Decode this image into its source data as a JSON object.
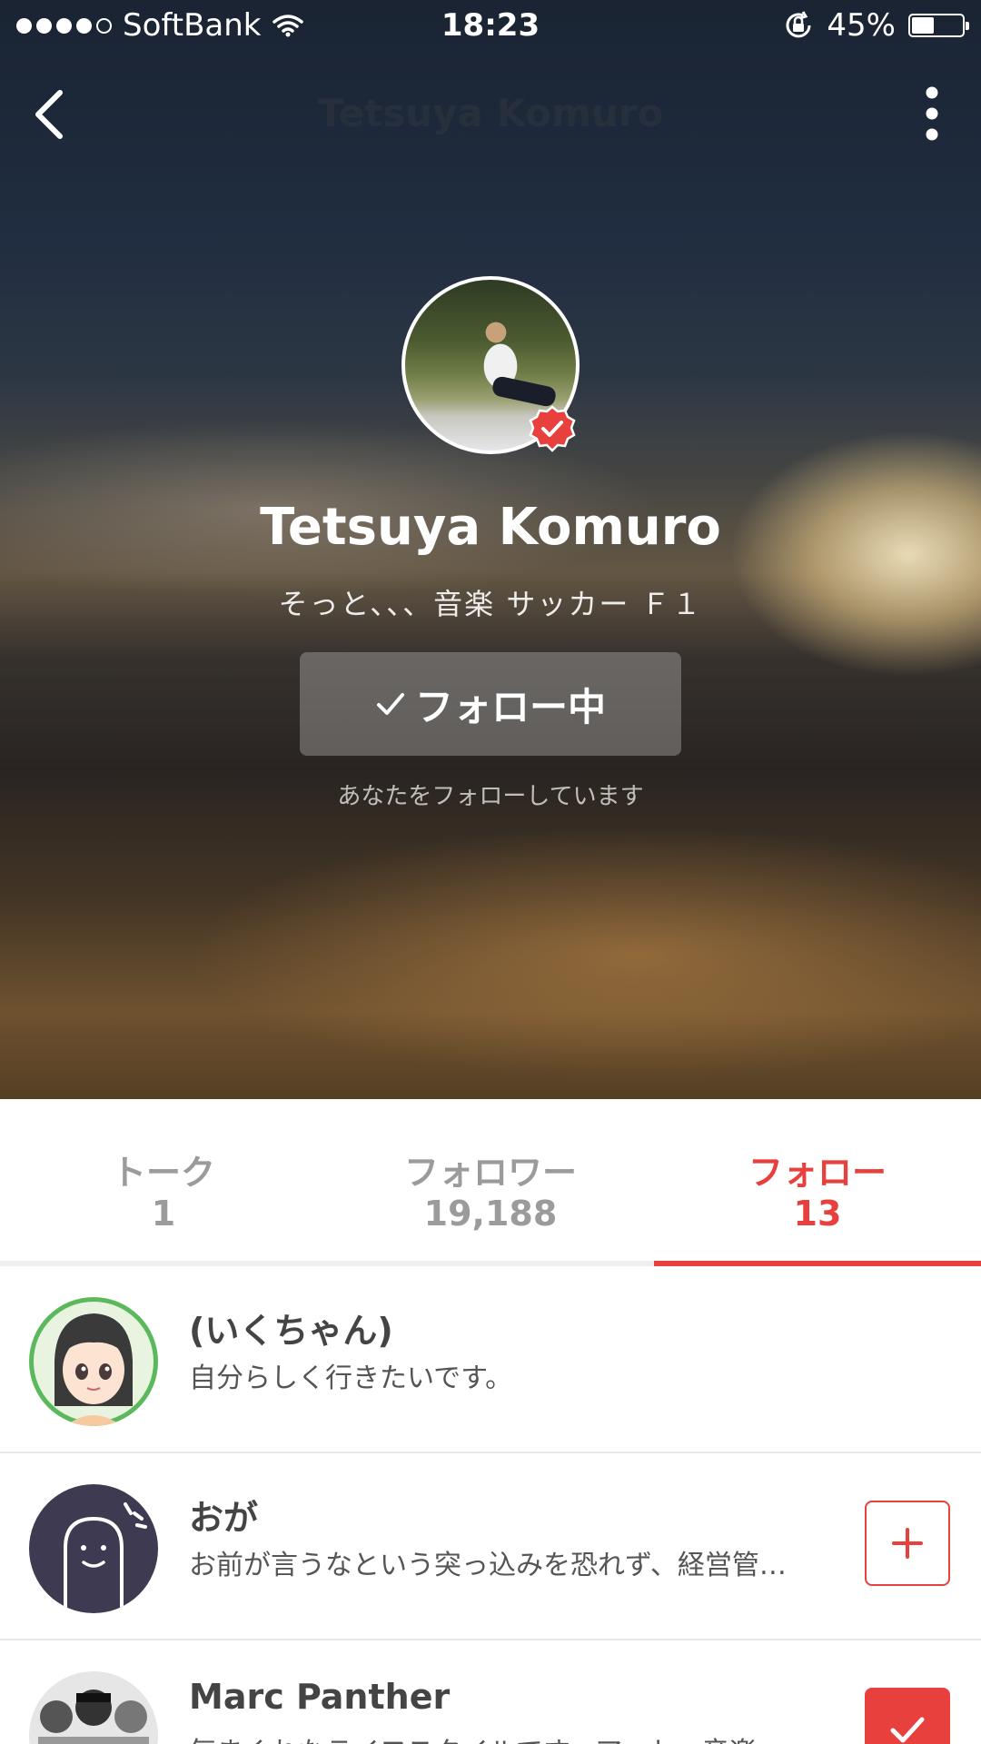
{
  "status_bar": {
    "carrier": "SoftBank",
    "time": "18:23",
    "battery": "45%",
    "battery_level": 0.45,
    "signal_bars": 4,
    "signal_total": 5
  },
  "nav": {
    "title": "Tetsuya Komuro"
  },
  "profile": {
    "name": "Tetsuya Komuro",
    "bio": "そっと、、、音楽 サッカー Ｆ１",
    "follow_button_label": "フォロー中",
    "follows_you_text": "あなたをフォローしています",
    "verified": true
  },
  "tabs": [
    {
      "label": "トーク",
      "count": "1",
      "active": false
    },
    {
      "label": "フォロワー",
      "count": "19,188",
      "active": false
    },
    {
      "label": "フォロー",
      "count": "13",
      "active": true
    }
  ],
  "list": [
    {
      "name": "(いくちゃん)",
      "description": "自分らしく行きたいです。",
      "action": "none"
    },
    {
      "name": "おが",
      "description": "お前が言うなという突っ込みを恐れず、経営管…",
      "action": "follow"
    },
    {
      "name": "Marc Panther",
      "description": "気まぐれなライフスタイルです。アート、音楽…",
      "action": "following"
    }
  ],
  "colors": {
    "accent": "#e8403d",
    "tab_inactive": "#9b9b9b"
  },
  "icons": {
    "back": "chevron-left-icon",
    "more": "more-vertical-icon",
    "verified": "verified-check-icon",
    "wifi": "wifi-icon",
    "orientation_lock": "orientation-lock-icon",
    "add": "plus-icon",
    "check": "check-icon"
  }
}
